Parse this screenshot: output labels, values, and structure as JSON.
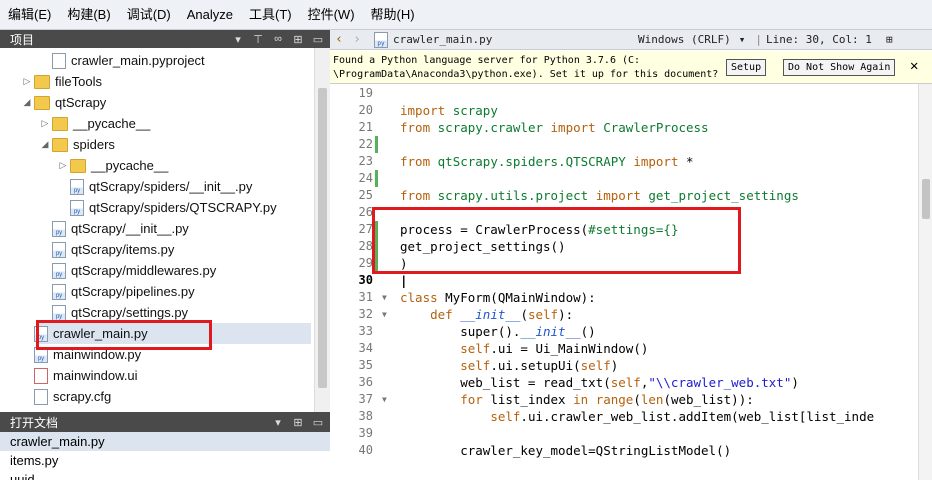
{
  "menu": [
    "编辑(E)",
    "构建(B)",
    "调试(D)",
    "Analyze",
    "工具(T)",
    "控件(W)",
    "帮助(H)"
  ],
  "project": {
    "title": "项目",
    "items": [
      {
        "label": "crawler_main.pyproject",
        "kind": "file",
        "depth": 1
      },
      {
        "label": "fileTools",
        "kind": "folder",
        "depth": 0,
        "arrow": "▷"
      },
      {
        "label": "qtScrapy",
        "kind": "folder",
        "depth": 0,
        "arrow": "◢"
      },
      {
        "label": "__pycache__",
        "kind": "folder",
        "depth": 1,
        "arrow": "▷"
      },
      {
        "label": "spiders",
        "kind": "folder",
        "depth": 1,
        "arrow": "◢"
      },
      {
        "label": "__pycache__",
        "kind": "folder",
        "depth": 2,
        "arrow": "▷"
      },
      {
        "label": "qtScrapy/spiders/__init__.py",
        "kind": "py",
        "depth": 2
      },
      {
        "label": "qtScrapy/spiders/QTSCRAPY.py",
        "kind": "py",
        "depth": 2
      },
      {
        "label": "qtScrapy/__init__.py",
        "kind": "py",
        "depth": 1
      },
      {
        "label": "qtScrapy/items.py",
        "kind": "py",
        "depth": 1
      },
      {
        "label": "qtScrapy/middlewares.py",
        "kind": "py",
        "depth": 1
      },
      {
        "label": "qtScrapy/pipelines.py",
        "kind": "py",
        "depth": 1
      },
      {
        "label": "qtScrapy/settings.py",
        "kind": "py",
        "depth": 1
      },
      {
        "label": "crawler_main.py",
        "kind": "py",
        "depth": 0
      },
      {
        "label": "mainwindow.py",
        "kind": "py",
        "depth": 0
      },
      {
        "label": "mainwindow.ui",
        "kind": "ui",
        "depth": 0
      },
      {
        "label": "scrapy.cfg",
        "kind": "file",
        "depth": 0
      }
    ]
  },
  "open_docs": {
    "title": "打开文档",
    "items": [
      "crawler_main.py",
      "items.py",
      "uuid"
    ]
  },
  "editor": {
    "filename": "crawler_main.py",
    "line_ending": "Windows (CRLF)",
    "position": "Line: 30, Col: 1",
    "notice_line1": "Found a Python language server for Python 3.7.6 (C:",
    "notice_line2": "\\ProgramData\\Anaconda3\\python.exe). Set it up for this document?",
    "setup_label": "Setup",
    "dont_show_label": "Do Not Show Again"
  },
  "code_lines": [
    {
      "n": "19",
      "tokens": []
    },
    {
      "n": "20",
      "tokens": [
        [
          "kw",
          "import "
        ],
        [
          "mod",
          "scrapy"
        ]
      ]
    },
    {
      "n": "21",
      "tokens": [
        [
          "kw",
          "from "
        ],
        [
          "mod",
          "scrapy.crawler "
        ],
        [
          "kw",
          "import "
        ],
        [
          "mod",
          "CrawlerProcess"
        ]
      ]
    },
    {
      "n": "22",
      "tokens": [],
      "mark": true
    },
    {
      "n": "23",
      "tokens": [
        [
          "kw",
          "from "
        ],
        [
          "mod",
          "qtScrapy.spiders.QTSCRAPY "
        ],
        [
          "kw",
          "import "
        ],
        [
          "cls",
          "*"
        ]
      ]
    },
    {
      "n": "24",
      "tokens": [],
      "mark": true
    },
    {
      "n": "25",
      "tokens": [
        [
          "kw",
          "from "
        ],
        [
          "mod",
          "scrapy.utils.project "
        ],
        [
          "kw",
          "import "
        ],
        [
          "mod",
          "get_project_settings"
        ]
      ]
    },
    {
      "n": "26",
      "tokens": []
    },
    {
      "n": "27",
      "tokens": [
        [
          "cls",
          "process = CrawlerProcess("
        ],
        [
          "cm",
          "#settings={}"
        ]
      ],
      "mark": true
    },
    {
      "n": "28",
      "tokens": [
        [
          "cls",
          "get_project_settings()"
        ]
      ],
      "mark": true
    },
    {
      "n": "29",
      "tokens": [
        [
          "cls",
          ")"
        ]
      ],
      "mark": true
    },
    {
      "n": "30",
      "tokens": [
        [
          "cls",
          ""
        ]
      ],
      "bold": true
    },
    {
      "n": "31",
      "tokens": [
        [
          "kw",
          "class "
        ],
        [
          "cls",
          "MyForm(QMainWindow):"
        ]
      ],
      "fold": true
    },
    {
      "n": "32",
      "tokens": [
        [
          "cls",
          "    "
        ],
        [
          "kw",
          "def "
        ],
        [
          "dn",
          "__init__"
        ],
        [
          "cls",
          "("
        ],
        [
          "self",
          "self"
        ],
        [
          "cls",
          "):"
        ]
      ],
      "fold": true
    },
    {
      "n": "33",
      "tokens": [
        [
          "cls",
          "        super()."
        ],
        [
          "dn",
          "__init__"
        ],
        [
          "cls",
          "()"
        ]
      ]
    },
    {
      "n": "34",
      "tokens": [
        [
          "cls",
          "        "
        ],
        [
          "self",
          "self"
        ],
        [
          "cls",
          ".ui = Ui_MainWindow()"
        ]
      ]
    },
    {
      "n": "35",
      "tokens": [
        [
          "cls",
          "        "
        ],
        [
          "self",
          "self"
        ],
        [
          "cls",
          ".ui.setupUi("
        ],
        [
          "self",
          "self"
        ],
        [
          "cls",
          ")"
        ]
      ]
    },
    {
      "n": "36",
      "tokens": [
        [
          "cls",
          "        web_list = read_txt("
        ],
        [
          "self",
          "self"
        ],
        [
          "cls",
          ","
        ],
        [
          "st",
          "\"\\\\crawler_web.txt\""
        ],
        [
          "cls",
          ")"
        ]
      ]
    },
    {
      "n": "37",
      "tokens": [
        [
          "cls",
          "        "
        ],
        [
          "kw",
          "for "
        ],
        [
          "cls",
          "list_index "
        ],
        [
          "kw",
          "in "
        ],
        [
          "kw",
          "range"
        ],
        [
          "cls",
          "("
        ],
        [
          "kw",
          "len"
        ],
        [
          "cls",
          "(web_list)):"
        ]
      ],
      "fold": true
    },
    {
      "n": "38",
      "tokens": [
        [
          "cls",
          "            "
        ],
        [
          "self",
          "self"
        ],
        [
          "cls",
          ".ui.crawler_web_list.addItem(web_list[list_inde"
        ]
      ]
    },
    {
      "n": "39",
      "tokens": []
    },
    {
      "n": "40",
      "tokens": [
        [
          "cls",
          "        crawler_key_model=QStringListModel()"
        ]
      ]
    }
  ]
}
